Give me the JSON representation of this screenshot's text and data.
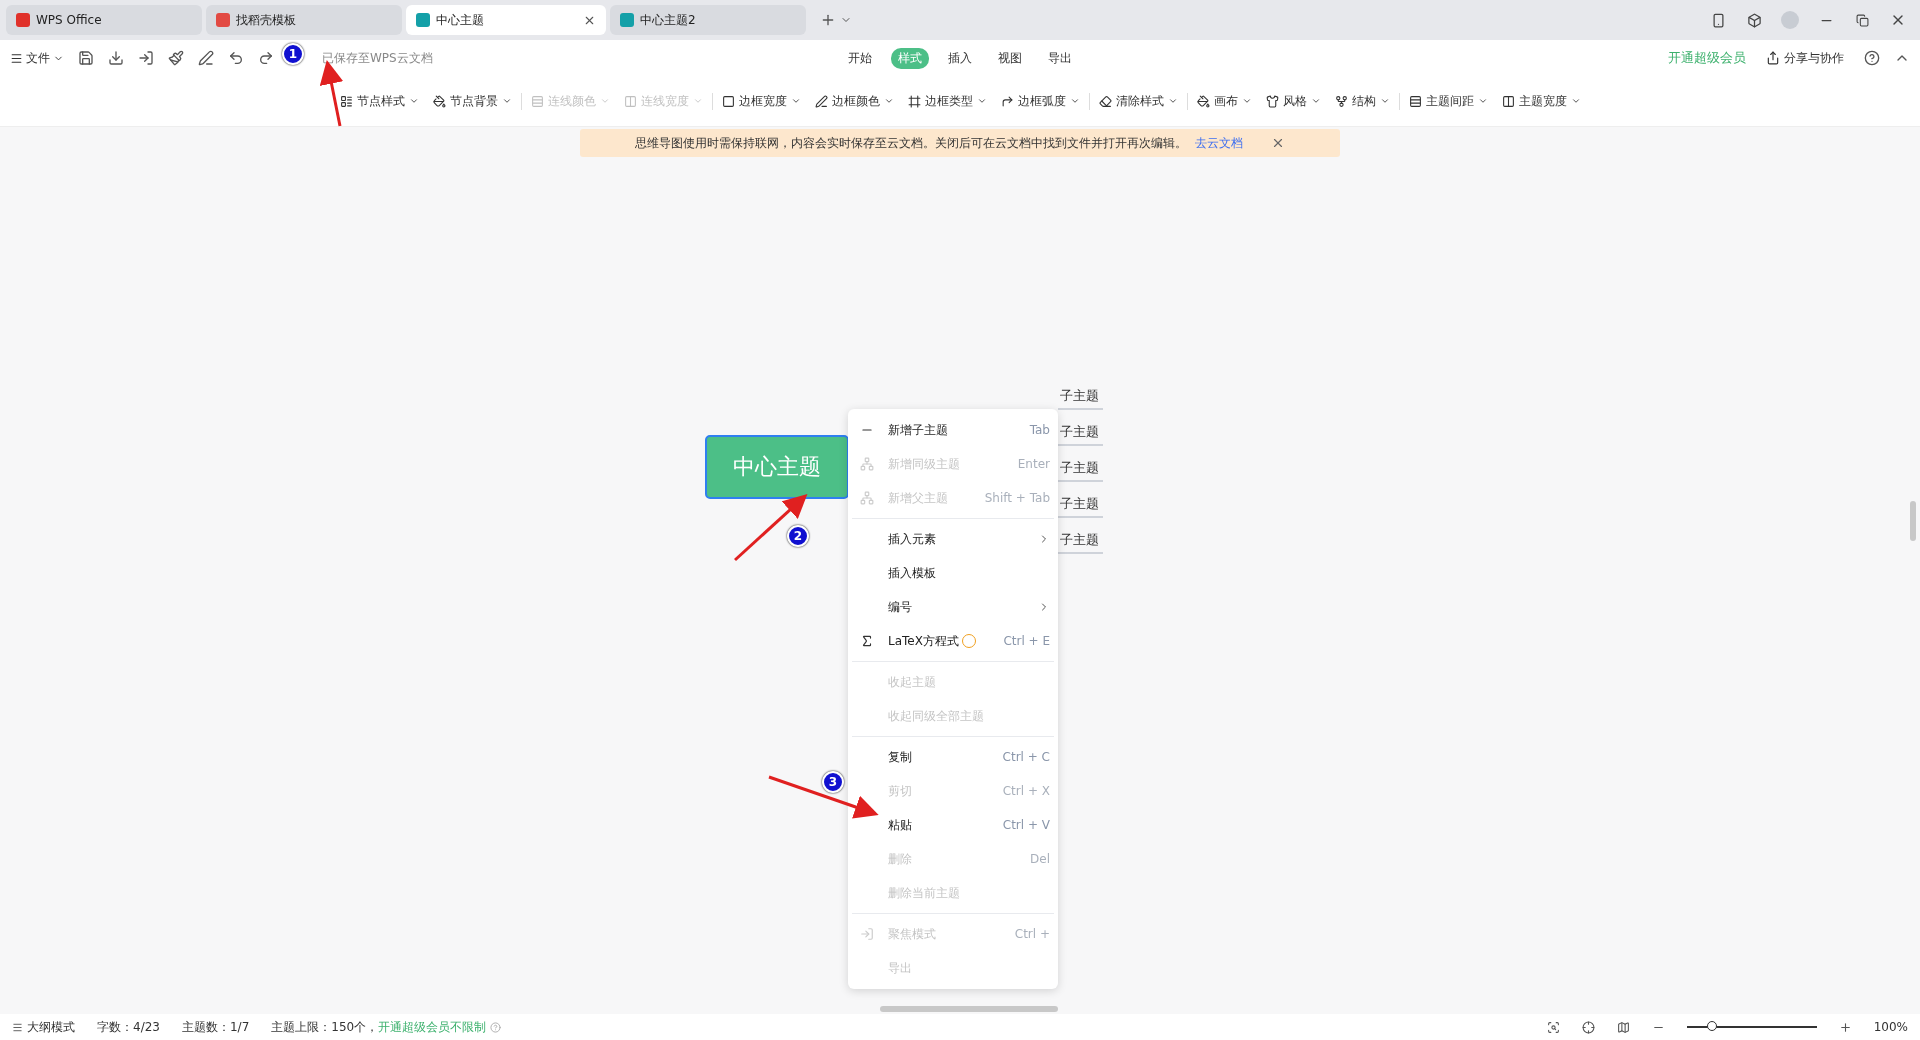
{
  "tabs": [
    {
      "label": "WPS Office",
      "kind": "home",
      "selected": false
    },
    {
      "label": "找稻壳模板",
      "kind": "template",
      "selected": false
    },
    {
      "label": "中心主题",
      "kind": "doc",
      "selected": true
    },
    {
      "label": "中心主题2",
      "kind": "doc",
      "selected": false
    }
  ],
  "toolbar": {
    "file_menu": "文件",
    "save_status": "已保存至WPS云文档",
    "ribbon_tabs": [
      {
        "label": "开始",
        "selected": false
      },
      {
        "label": "样式",
        "selected": true
      },
      {
        "label": "插入",
        "selected": false
      },
      {
        "label": "视图",
        "selected": false
      },
      {
        "label": "导出",
        "selected": false
      }
    ],
    "vip": "开通超级会员",
    "share": "分享与协作"
  },
  "format_groups": [
    [
      {
        "label": "节点样式",
        "disabled": false
      },
      {
        "label": "节点背景",
        "disabled": false
      }
    ],
    [
      {
        "label": "连线颜色",
        "disabled": true
      },
      {
        "label": "连线宽度",
        "disabled": true
      }
    ],
    [
      {
        "label": "边框宽度",
        "disabled": false
      },
      {
        "label": "边框颜色",
        "disabled": false
      },
      {
        "label": "边框类型",
        "disabled": false
      },
      {
        "label": "边框弧度",
        "disabled": false
      }
    ],
    [
      {
        "label": "清除样式",
        "disabled": false
      }
    ],
    [
      {
        "label": "画布",
        "disabled": false
      },
      {
        "label": "风格",
        "disabled": false
      },
      {
        "label": "结构",
        "disabled": false
      }
    ],
    [
      {
        "label": "主题间距",
        "disabled": false
      },
      {
        "label": "主题宽度",
        "disabled": false
      }
    ]
  ],
  "banner": {
    "message": "思维导图使用时需保持联网，内容会实时保存至云文档。关闭后可在云文档中找到文件并打开再次编辑。",
    "link": "去云文档"
  },
  "mindmap": {
    "center": "中心主题",
    "children": [
      "子主题",
      "子主题",
      "子主题",
      "子主题",
      "子主题"
    ]
  },
  "context_menu": [
    {
      "kind": "item",
      "label": "新增子主题",
      "shortcut": "Tab",
      "disabled": false,
      "submenu": false
    },
    {
      "kind": "item",
      "label": "新增同级主题",
      "shortcut": "Enter",
      "disabled": true,
      "submenu": false
    },
    {
      "kind": "item",
      "label": "新增父主题",
      "shortcut": "Shift + Tab",
      "disabled": true,
      "submenu": false
    },
    {
      "kind": "divider"
    },
    {
      "kind": "item",
      "label": "插入元素",
      "disabled": false,
      "submenu": true
    },
    {
      "kind": "item",
      "label": "插入模板",
      "disabled": false,
      "submenu": false
    },
    {
      "kind": "item",
      "label": "编号",
      "disabled": false,
      "submenu": true
    },
    {
      "kind": "item",
      "label": "LaTeX方程式",
      "shortcut": "Ctrl + E",
      "disabled": false,
      "submenu": false
    },
    {
      "kind": "divider"
    },
    {
      "kind": "item",
      "label": "收起主题",
      "disabled": true,
      "submenu": false
    },
    {
      "kind": "item",
      "label": "收起同级全部主题",
      "disabled": true,
      "submenu": false
    },
    {
      "kind": "divider"
    },
    {
      "kind": "item",
      "label": "复制",
      "shortcut": "Ctrl + C",
      "disabled": false,
      "submenu": false
    },
    {
      "kind": "item",
      "label": "剪切",
      "shortcut": "Ctrl + X",
      "disabled": true,
      "submenu": false
    },
    {
      "kind": "item",
      "label": "粘贴",
      "shortcut": "Ctrl + V",
      "disabled": false,
      "submenu": false
    },
    {
      "kind": "item",
      "label": "删除",
      "shortcut": "Del",
      "disabled": true,
      "submenu": false
    },
    {
      "kind": "item",
      "label": "删除当前主题",
      "disabled": true,
      "submenu": false
    },
    {
      "kind": "divider"
    },
    {
      "kind": "item",
      "label": "聚焦模式",
      "shortcut": "Ctrl +",
      "disabled": true,
      "submenu": false
    },
    {
      "kind": "item",
      "label": "导出",
      "disabled": true,
      "submenu": false
    }
  ],
  "annotations": [
    {
      "label": "1"
    },
    {
      "label": "2"
    },
    {
      "label": "3"
    }
  ],
  "status_bar": {
    "outline": "大纲模式",
    "word_count": "字数：4/23",
    "topic_count": "主题数：1/7",
    "topic_limit": "主题上限：150个，",
    "vip_link": "开通超级会员不限制",
    "zoom": {
      "level": 0.2,
      "reading": "100%"
    }
  }
}
